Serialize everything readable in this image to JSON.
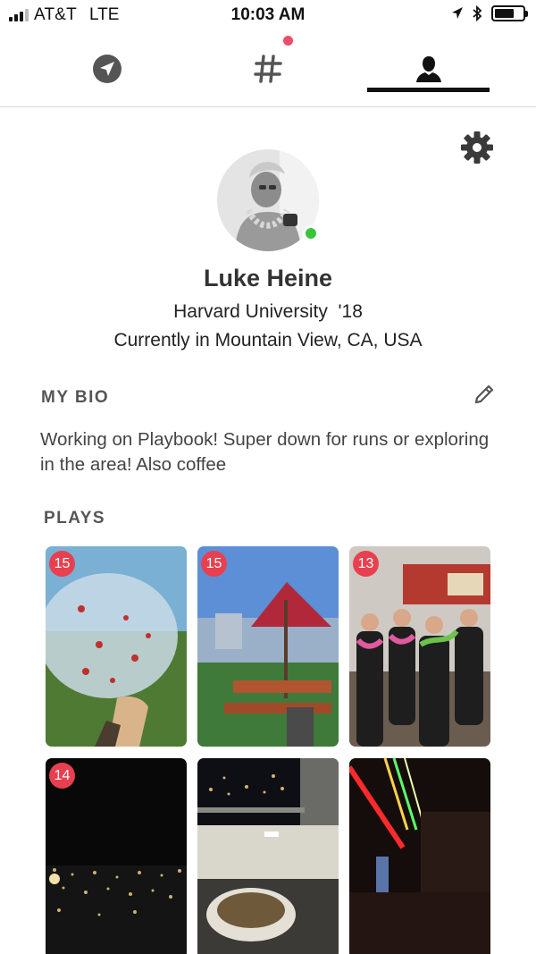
{
  "status_bar": {
    "carrier": "AT&T",
    "network": "LTE",
    "time": "10:03 AM"
  },
  "tabs": [
    {
      "name": "nearby",
      "icon": "location-arrow-icon"
    },
    {
      "name": "hashtags",
      "icon": "hashtag-icon",
      "has_notification": true
    },
    {
      "name": "profile",
      "icon": "person-icon",
      "active": true
    }
  ],
  "profile": {
    "name": "Luke Heine",
    "school": "Harvard University  '18",
    "location": "Currently in Mountain View, CA, USA",
    "online": true
  },
  "bio": {
    "label": "MY BIO",
    "text": "Working on Playbook! Super down for runs or exploring in the area! Also coffee"
  },
  "plays": {
    "label": "PLAYS",
    "items": [
      {
        "badge": "15",
        "scene": "bubble soccer on grass"
      },
      {
        "badge": "15",
        "scene": "red umbrella over picnic tables"
      },
      {
        "badge": "13",
        "scene": "group photo with leis"
      },
      {
        "badge": "14",
        "scene": "night city lights"
      },
      {
        "badge": "",
        "scene": "night view from balcony with food"
      },
      {
        "badge": "",
        "scene": "neon lights in dark bar"
      }
    ]
  },
  "colors": {
    "badge": "#e8404f",
    "online": "#3bc43b",
    "notification": "#ee4d6a",
    "tab_active": "#111111",
    "tab_inactive": "#555555"
  }
}
